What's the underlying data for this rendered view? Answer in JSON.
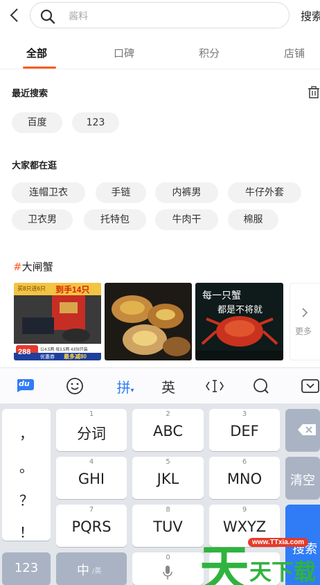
{
  "search": {
    "placeholder": "酱料",
    "button_label": "搜索"
  },
  "tabs": [
    {
      "label": "全部",
      "active": true
    },
    {
      "label": "口碑",
      "active": false
    },
    {
      "label": "积分",
      "active": false
    },
    {
      "label": "店铺",
      "active": false
    }
  ],
  "recent": {
    "title": "最近搜索",
    "items": [
      "百度",
      "123"
    ]
  },
  "popular": {
    "title": "大家都在逛",
    "items": [
      "连帽卫衣",
      "手链",
      "内裤男",
      "牛仔外套",
      "卫衣男",
      "托特包",
      "牛肉干",
      "棉服"
    ]
  },
  "topic": {
    "hash": "#",
    "title": "大闸蟹",
    "more_label": "更多",
    "thumb1": {
      "badge": "买8只送6只",
      "headline": "到手14只",
      "price": "288",
      "detail": "公4.5两 母3.5两 4对8只装",
      "coupon": "优惠券",
      "coupon_value": "最多减80"
    },
    "thumb3": {
      "slogan1": "每一只蟹",
      "slogan2": "都是不将就"
    }
  },
  "keyboard": {
    "toolbar": {
      "logo": "du",
      "pinyin": "拼",
      "english": "英"
    },
    "punct": [
      "，",
      "。",
      "？",
      "！"
    ],
    "keys": [
      {
        "num": "1",
        "label": "分词"
      },
      {
        "num": "2",
        "label": "ABC"
      },
      {
        "num": "3",
        "label": "DEF"
      },
      {
        "num": "4",
        "label": "GHI"
      },
      {
        "num": "5",
        "label": "JKL"
      },
      {
        "num": "6",
        "label": "MNO"
      },
      {
        "num": "7",
        "label": "PQRS"
      },
      {
        "num": "8",
        "label": "TUV"
      },
      {
        "num": "9",
        "label": "WXYZ"
      },
      {
        "num": "0",
        "label": ""
      }
    ],
    "clear_label": "清空",
    "num_switch": "123",
    "zh_label": "中",
    "zh_sub": "/英",
    "enter_label": "搜索"
  },
  "watermark": {
    "big": "天",
    "text": "天下载",
    "url": "www.TTxia.com"
  },
  "colors": {
    "accent": "#ff5a1f",
    "enter_key": "#2f7cf6",
    "keyboard_bg": "#e2e5ea"
  }
}
